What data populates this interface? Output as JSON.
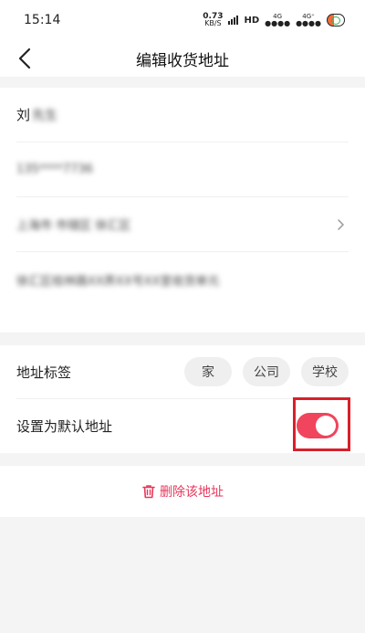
{
  "status_bar": {
    "time": "15:14",
    "net_speed_value": "0.73",
    "net_speed_unit": "KB/S",
    "hd_label": "HD",
    "net1": "4G",
    "net2": "4G⁺"
  },
  "header": {
    "title": "编辑收货地址",
    "back_icon": "chevron-left-icon"
  },
  "address_form": {
    "name": "刘",
    "name_blurred": "先生",
    "phone_blurred": "135****7736",
    "region_blurred": "上海市 市辖区 徐汇区",
    "detail_blurred": "徐汇区桂林路XX弄XX号XX室收货单元",
    "region_chevron_icon": "chevron-right-icon"
  },
  "tags_section": {
    "label": "地址标签",
    "tags": [
      "家",
      "公司",
      "学校"
    ]
  },
  "default_section": {
    "label": "设置为默认地址",
    "toggle_on": true,
    "toggle_color": "#f0455c"
  },
  "delete": {
    "label": "删除该地址",
    "icon": "trash-icon",
    "color": "#e8365b"
  }
}
